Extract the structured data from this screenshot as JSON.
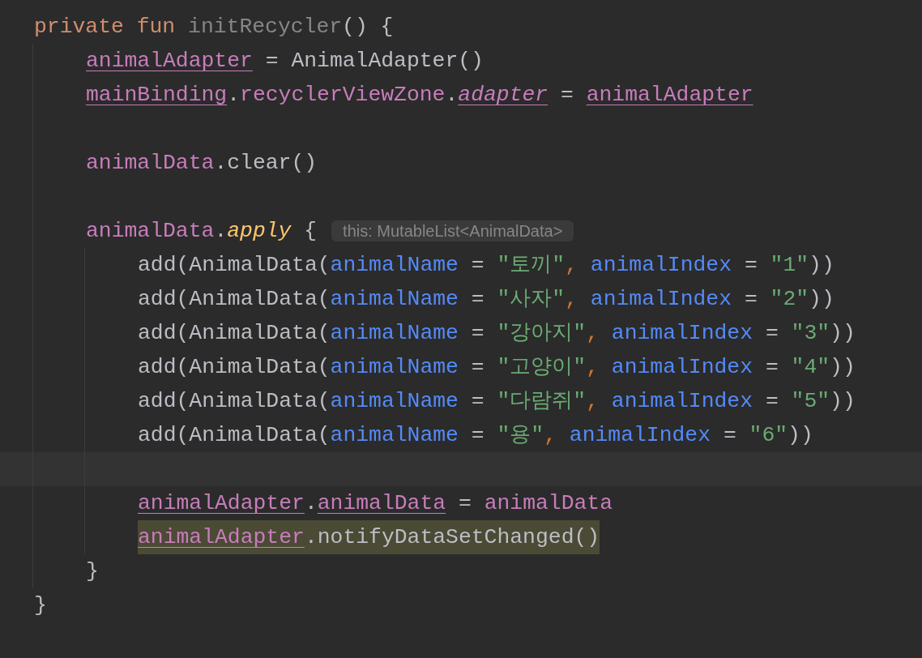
{
  "editor": {
    "lines": [
      {
        "kind": "code",
        "highlighted": false,
        "tokens": [
          {
            "text": "private fun ",
            "kind": "keyword"
          },
          {
            "text": "initRecycler",
            "kind": "unused"
          },
          {
            "text": "() {",
            "kind": "plain"
          }
        ],
        "children": [
          {
            "kind": "code",
            "highlighted": false,
            "tokens": [
              {
                "text": "animalAdapter",
                "kind": "property-underlined"
              },
              {
                "text": " = AnimalAdapter()",
                "kind": "plain"
              }
            ]
          },
          {
            "kind": "code",
            "highlighted": false,
            "tokens": [
              {
                "text": "mainBinding",
                "kind": "property-underlined"
              },
              {
                "text": ".",
                "kind": "plain"
              },
              {
                "text": "recyclerViewZone",
                "kind": "property"
              },
              {
                "text": ".",
                "kind": "plain"
              },
              {
                "text": "adapter",
                "kind": "property-italic"
              },
              {
                "text": " = ",
                "kind": "plain"
              },
              {
                "text": "animalAdapter",
                "kind": "property-underlined"
              }
            ]
          },
          {
            "kind": "blank"
          },
          {
            "kind": "code",
            "highlighted": false,
            "tokens": [
              {
                "text": "animalData",
                "kind": "property"
              },
              {
                "text": ".clear()",
                "kind": "plain"
              }
            ]
          },
          {
            "kind": "blank"
          },
          {
            "kind": "code",
            "highlighted": false,
            "tokens": [
              {
                "text": "animalData",
                "kind": "property"
              },
              {
                "text": ".",
                "kind": "plain"
              },
              {
                "text": "apply",
                "kind": "extension"
              },
              {
                "text": " {",
                "kind": "plain"
              }
            ],
            "hint": "this: MutableList<AnimalData>",
            "children": [
              {
                "kind": "code",
                "highlighted": false,
                "tokens": [
                  {
                    "text": "add(AnimalData(",
                    "kind": "plain"
                  },
                  {
                    "text": "animalName",
                    "kind": "named-arg"
                  },
                  {
                    "text": " = ",
                    "kind": "plain"
                  },
                  {
                    "text": "\"토끼\"",
                    "kind": "string"
                  },
                  {
                    "text": ", ",
                    "kind": "separator"
                  },
                  {
                    "text": "animalIndex",
                    "kind": "named-arg"
                  },
                  {
                    "text": " = ",
                    "kind": "plain"
                  },
                  {
                    "text": "\"1\"",
                    "kind": "string"
                  },
                  {
                    "text": "))",
                    "kind": "plain"
                  }
                ]
              },
              {
                "kind": "code",
                "highlighted": false,
                "tokens": [
                  {
                    "text": "add(AnimalData(",
                    "kind": "plain"
                  },
                  {
                    "text": "animalName",
                    "kind": "named-arg"
                  },
                  {
                    "text": " = ",
                    "kind": "plain"
                  },
                  {
                    "text": "\"사자\"",
                    "kind": "string"
                  },
                  {
                    "text": ", ",
                    "kind": "separator"
                  },
                  {
                    "text": "animalIndex",
                    "kind": "named-arg"
                  },
                  {
                    "text": " = ",
                    "kind": "plain"
                  },
                  {
                    "text": "\"2\"",
                    "kind": "string"
                  },
                  {
                    "text": "))",
                    "kind": "plain"
                  }
                ]
              },
              {
                "kind": "code",
                "highlighted": false,
                "tokens": [
                  {
                    "text": "add(AnimalData(",
                    "kind": "plain"
                  },
                  {
                    "text": "animalName",
                    "kind": "named-arg"
                  },
                  {
                    "text": " = ",
                    "kind": "plain"
                  },
                  {
                    "text": "\"강아지\"",
                    "kind": "string"
                  },
                  {
                    "text": ", ",
                    "kind": "separator"
                  },
                  {
                    "text": "animalIndex",
                    "kind": "named-arg"
                  },
                  {
                    "text": " = ",
                    "kind": "plain"
                  },
                  {
                    "text": "\"3\"",
                    "kind": "string"
                  },
                  {
                    "text": "))",
                    "kind": "plain"
                  }
                ]
              },
              {
                "kind": "code",
                "highlighted": false,
                "tokens": [
                  {
                    "text": "add(AnimalData(",
                    "kind": "plain"
                  },
                  {
                    "text": "animalName",
                    "kind": "named-arg"
                  },
                  {
                    "text": " = ",
                    "kind": "plain"
                  },
                  {
                    "text": "\"고양이\"",
                    "kind": "string"
                  },
                  {
                    "text": ", ",
                    "kind": "separator"
                  },
                  {
                    "text": "animalIndex",
                    "kind": "named-arg"
                  },
                  {
                    "text": " = ",
                    "kind": "plain"
                  },
                  {
                    "text": "\"4\"",
                    "kind": "string"
                  },
                  {
                    "text": "))",
                    "kind": "plain"
                  }
                ]
              },
              {
                "kind": "code",
                "highlighted": false,
                "tokens": [
                  {
                    "text": "add(AnimalData(",
                    "kind": "plain"
                  },
                  {
                    "text": "animalName",
                    "kind": "named-arg"
                  },
                  {
                    "text": " = ",
                    "kind": "plain"
                  },
                  {
                    "text": "\"다람쥐\"",
                    "kind": "string"
                  },
                  {
                    "text": ", ",
                    "kind": "separator"
                  },
                  {
                    "text": "animalIndex",
                    "kind": "named-arg"
                  },
                  {
                    "text": " = ",
                    "kind": "plain"
                  },
                  {
                    "text": "\"5\"",
                    "kind": "string"
                  },
                  {
                    "text": "))",
                    "kind": "plain"
                  }
                ]
              },
              {
                "kind": "code",
                "highlighted": false,
                "tokens": [
                  {
                    "text": "add(AnimalData(",
                    "kind": "plain"
                  },
                  {
                    "text": "animalName",
                    "kind": "named-arg"
                  },
                  {
                    "text": " = ",
                    "kind": "plain"
                  },
                  {
                    "text": "\"용\"",
                    "kind": "string"
                  },
                  {
                    "text": ", ",
                    "kind": "separator"
                  },
                  {
                    "text": "animalIndex",
                    "kind": "named-arg"
                  },
                  {
                    "text": " = ",
                    "kind": "plain"
                  },
                  {
                    "text": "\"6\"",
                    "kind": "string"
                  },
                  {
                    "text": "))",
                    "kind": "plain"
                  }
                ]
              },
              {
                "kind": "blank",
                "caret_line": true
              },
              {
                "kind": "code",
                "highlighted": false,
                "tokens": [
                  {
                    "text": "animalAdapter",
                    "kind": "property-underlined"
                  },
                  {
                    "text": ".",
                    "kind": "plain"
                  },
                  {
                    "text": "animalData",
                    "kind": "property-underlined"
                  },
                  {
                    "text": " = ",
                    "kind": "plain"
                  },
                  {
                    "text": "animalData",
                    "kind": "property"
                  }
                ]
              },
              {
                "kind": "code",
                "highlighted": true,
                "tokens": [
                  {
                    "text": "animalAdapter",
                    "kind": "property-underlined"
                  },
                  {
                    "text": ".notifyDataSetChanged()",
                    "kind": "plain"
                  }
                ]
              }
            ]
          },
          {
            "kind": "code",
            "highlighted": false,
            "tokens": [
              {
                "text": "}",
                "kind": "plain"
              }
            ]
          }
        ]
      },
      {
        "kind": "code",
        "highlighted": false,
        "tokens": [
          {
            "text": "}",
            "kind": "plain"
          }
        ]
      }
    ]
  }
}
